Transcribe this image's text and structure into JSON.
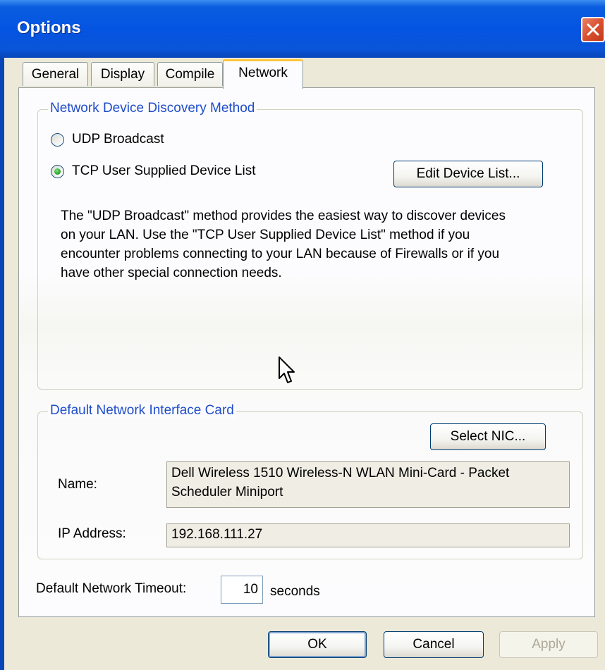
{
  "window": {
    "title": "Options"
  },
  "tabs": [
    {
      "label": "General"
    },
    {
      "label": "Display"
    },
    {
      "label": "Compile"
    },
    {
      "label": "Network"
    }
  ],
  "discovery": {
    "legend": "Network Device Discovery Method",
    "options": [
      {
        "label": "UDP Broadcast",
        "checked": false
      },
      {
        "label": "TCP User Supplied Device List",
        "checked": true
      }
    ],
    "edit_button": "Edit Device List...",
    "description": [
      "The \"UDP Broadcast\" method provides the easiest way to discover devices",
      "on your LAN.  Use the \"TCP User Supplied Device List\" method if you",
      "encounter problems connecting to your LAN because of Firewalls or if you",
      "have other special connection needs."
    ]
  },
  "nic": {
    "legend": "Default Network Interface Card",
    "select_button": "Select NIC...",
    "name_label": "Name:",
    "name_value_line1": "Dell Wireless 1510 Wireless-N WLAN Mini-Card - Packet",
    "name_value_line2": "Scheduler Miniport",
    "ip_label": "IP Address:",
    "ip_value": "192.168.111.27"
  },
  "timeout": {
    "label": "Default Network Timeout:",
    "value": "10",
    "unit": "seconds"
  },
  "buttons": {
    "ok": "OK",
    "cancel": "Cancel",
    "apply": "Apply"
  },
  "icons": [
    "close-icon",
    "mouse-cursor-icon"
  ],
  "colors": {
    "titlebar": "#0454e2",
    "legend_text": "#1f4cc9",
    "active_tab_accent": "#ffc73c"
  }
}
